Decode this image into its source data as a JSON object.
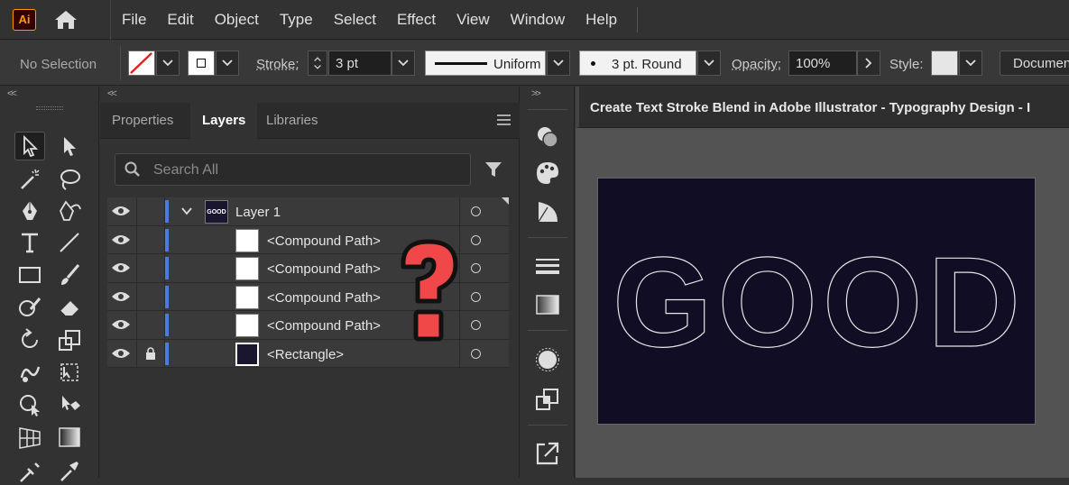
{
  "app": {
    "logo": "Ai"
  },
  "menu": [
    "File",
    "Edit",
    "Object",
    "Type",
    "Select",
    "Effect",
    "View",
    "Window",
    "Help"
  ],
  "control_bar": {
    "selection": "No Selection",
    "stroke_label": "Stroke:",
    "stroke_weight": "3 pt",
    "stroke_style": "Uniform",
    "brush": "3 pt. Round",
    "opacity_label": "Opacity:",
    "opacity_value": "100%",
    "style_label": "Style:",
    "document_button": "Documen"
  },
  "panel": {
    "tabs": [
      "Properties",
      "Layers",
      "Libraries"
    ],
    "active_tab": "Layers",
    "search_placeholder": "Search All",
    "layers": [
      {
        "name": "Layer 1",
        "thumb_text": "GOOD"
      },
      {
        "name": "<Compound Path>"
      },
      {
        "name": "<Compound Path>"
      },
      {
        "name": "<Compound Path>"
      },
      {
        "name": "<Compound Path>"
      },
      {
        "name": "<Rectangle>",
        "locked": true
      }
    ]
  },
  "document": {
    "title": "Create Text Stroke Blend in Adobe Illustrator - Typography Design - I",
    "artwork_text": "GOOD",
    "artboard_color": "#110d24"
  },
  "colors": {
    "accent": "#4a7cdc",
    "logo": "#ff9a00",
    "question_mark": "#f04848"
  },
  "icons": {
    "question_mark": "?"
  }
}
